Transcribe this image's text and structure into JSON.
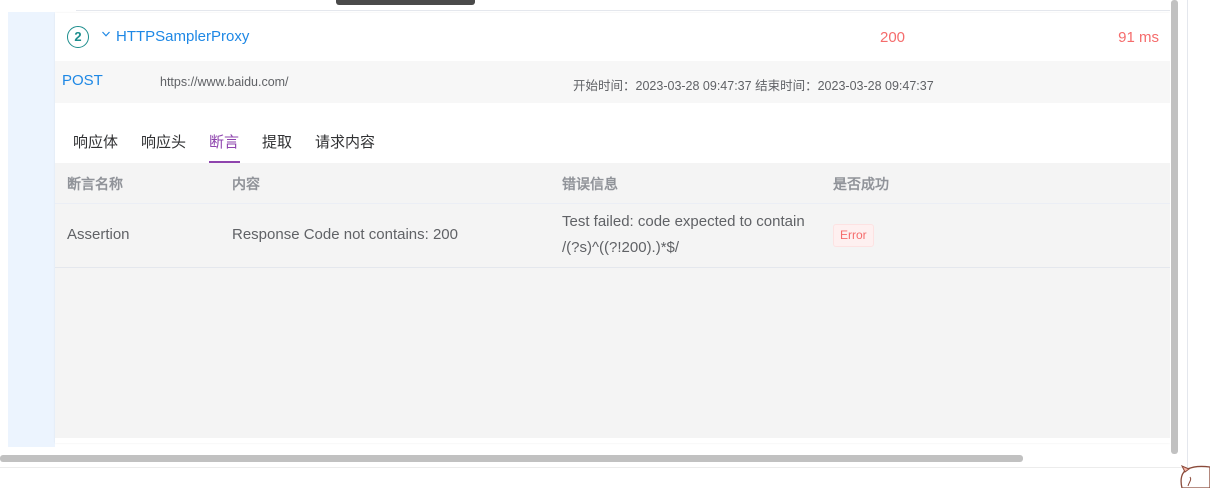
{
  "sampler": {
    "index": "2",
    "name": "HTTPSamplerProxy",
    "status_code": "200",
    "elapsed": "91 ms"
  },
  "request": {
    "method": "POST",
    "url": "https://www.baidu.com/",
    "start_label": "开始时间：",
    "start_time": "2023-03-28 09:47:37",
    "end_label": "结束时间：",
    "end_time": "2023-03-28 09:47:37"
  },
  "tabs": [
    {
      "label": "响应体"
    },
    {
      "label": "响应头"
    },
    {
      "label": "断言",
      "active": true
    },
    {
      "label": "提取"
    },
    {
      "label": "请求内容"
    }
  ],
  "assertion_table": {
    "headers": [
      "断言名称",
      "内容",
      "错误信息",
      "是否成功"
    ],
    "rows": [
      {
        "name": "Assertion",
        "content": "Response Code not contains: 200",
        "error": "Test failed: code expected to contain /(?s)^((?!200).)*$/",
        "status": "Error"
      }
    ]
  },
  "colors": {
    "link_blue": "#1e88e5",
    "error_red": "#f56c6c",
    "active_tab": "#8e44ad",
    "badge_teal": "#1c8d8d"
  }
}
